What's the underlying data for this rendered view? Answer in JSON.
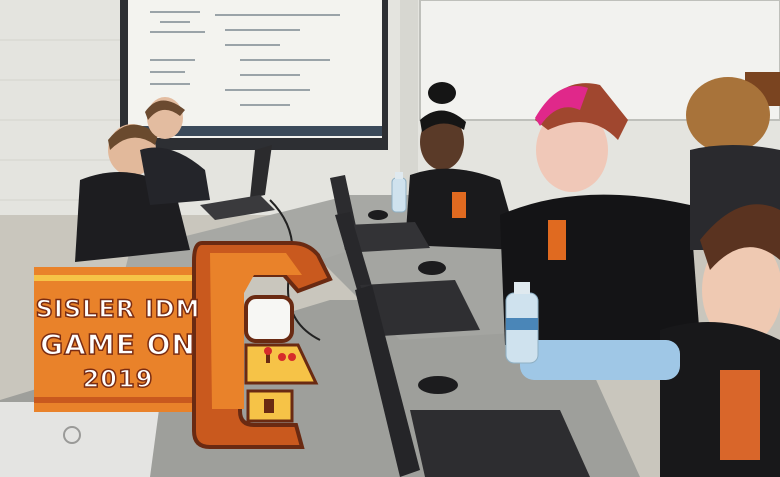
{
  "logo": {
    "line1": "SISLER IDM",
    "line2": "GAME ON",
    "line3": "2019"
  },
  "colors": {
    "logo_orange": "#e9822a",
    "logo_dark_orange": "#c9591e",
    "logo_brown": "#6a2a12",
    "logo_yellow": "#f6c347",
    "screen_white": "#f7f7f4"
  },
  "icons": [
    "arcade-cabinet-logo",
    "dell-logo"
  ]
}
